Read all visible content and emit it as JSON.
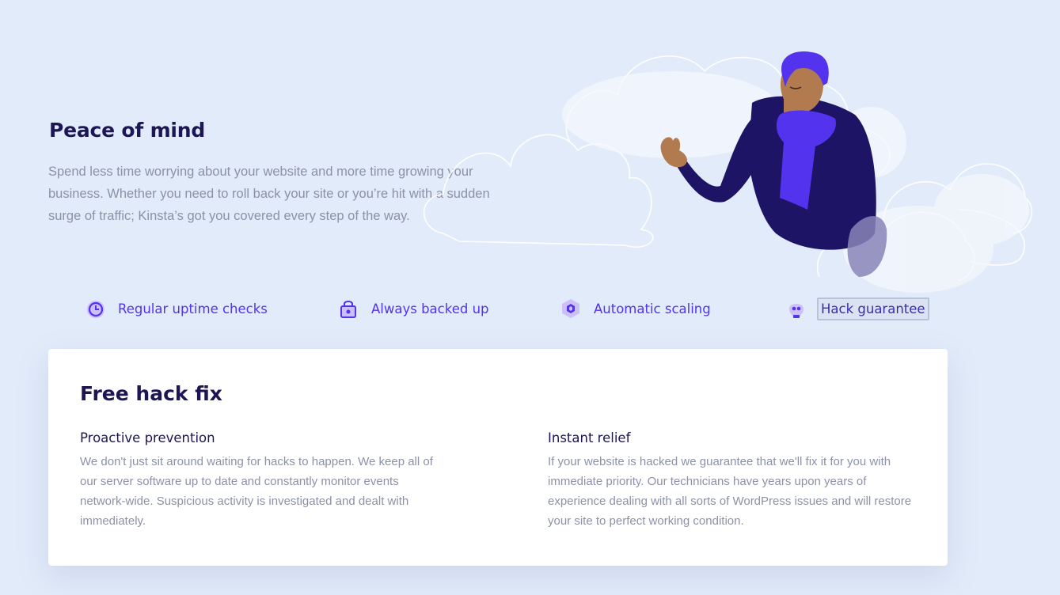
{
  "hero": {
    "title": "Peace of mind",
    "description": "Spend less time worrying about your website and more time growing your business. Whether you need to roll back your site or you’re hit with a sudden surge of traffic; Kinsta’s got you covered every step of the way."
  },
  "tabs": [
    {
      "label": "Regular uptime checks",
      "icon": "uptime-icon",
      "active": false
    },
    {
      "label": "Always backed up",
      "icon": "backup-lock-icon",
      "active": false
    },
    {
      "label": "Automatic scaling",
      "icon": "scaling-hexagon-icon",
      "active": false
    },
    {
      "label": "Hack guarantee",
      "icon": "hack-skull-icon",
      "active": true
    }
  ],
  "panel": {
    "title": "Free hack fix",
    "columns": [
      {
        "heading": "Proactive prevention",
        "body": "We don't just sit around waiting for hacks to happen. We keep all of our server software up to date and constantly monitor events network-wide. Suspicious activity is investigated and dealt with immediately."
      },
      {
        "heading": "Instant relief",
        "body": "If your website is hacked we guarantee that we'll fix it for you with immediate priority. Our technicians have years upon years of experience dealing with all sorts of WordPress issues and will restore your site to perfect working condition."
      }
    ]
  },
  "colors": {
    "background": "#e2ebf9",
    "accent": "#5333ed",
    "heading": "#1c1654",
    "body_text": "#8c91a8",
    "figure_navy": "#1e1466",
    "figure_skin": "#b27a4f"
  }
}
